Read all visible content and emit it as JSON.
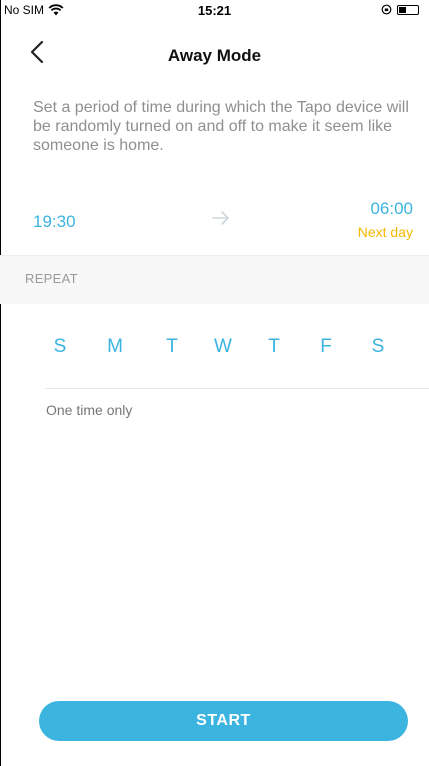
{
  "status_bar": {
    "carrier": "No SIM",
    "time": "15:21",
    "icons": [
      "wifi-icon",
      "orientation-lock-icon",
      "battery-icon"
    ]
  },
  "nav": {
    "title": "Away Mode",
    "back_icon": "chevron-left-icon"
  },
  "description": "Set a period of time during which the Tapo device will be randomly turned on and off to make it seem like someone is home.",
  "schedule": {
    "start_time": "19:30",
    "end_time": "06:00",
    "end_note": "Next day",
    "arrow_icon": "arrow-right-icon"
  },
  "repeat": {
    "label": "REPEAT",
    "days": [
      "S",
      "M",
      "T",
      "W",
      "T",
      "F",
      "S"
    ],
    "summary": "One time only"
  },
  "action": {
    "start_label": "START"
  },
  "colors": {
    "accent": "#3bb4e0",
    "next_day": "#f5b800",
    "muted_text": "#8f8f8f"
  }
}
